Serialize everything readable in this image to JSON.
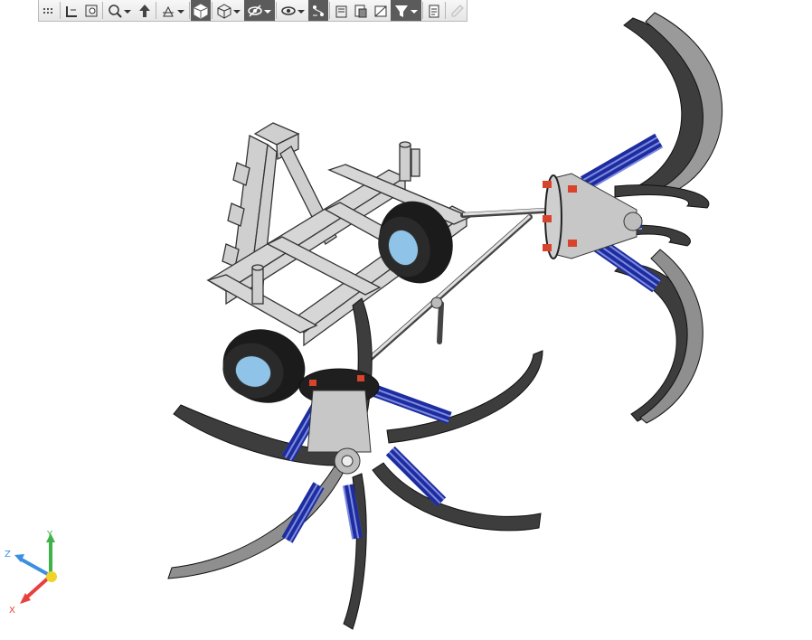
{
  "toolbar": {
    "buttons": [
      {
        "icon": "grip-icon"
      },
      {
        "icon": "zoom-to-fit-icon"
      },
      {
        "icon": "zoom-to-area-icon"
      },
      {
        "icon": "zoom-icon",
        "dropdown": true
      },
      {
        "icon": "previous-view-icon"
      },
      {
        "icon": "section-view-icon",
        "dropdown": true
      },
      {
        "icon": "view-orientation-icon",
        "active": true
      },
      {
        "icon": "display-style-icon",
        "dropdown": true
      },
      {
        "icon": "hide-show-items-icon",
        "active": true,
        "dropdown": true
      },
      {
        "icon": "edit-appearance-icon",
        "dropdown": true
      },
      {
        "icon": "apply-scene-icon",
        "active": true
      },
      {
        "icon": "view-settings-icon"
      },
      {
        "icon": "appearance-list-icon"
      },
      {
        "icon": "realview-icon"
      },
      {
        "icon": "filter-icon",
        "active": true,
        "dropdown": true
      },
      {
        "icon": "document-properties-icon"
      },
      {
        "icon": "pick-color-icon",
        "disabled": true
      }
    ]
  },
  "triad": {
    "x_label": "X",
    "y_label": "Y",
    "z_label": "Z",
    "x_color": "#e8403d",
    "y_color": "#3fb24a",
    "z_color": "#3b8fe0",
    "origin_color": "#f0d22a"
  },
  "model": {
    "frame_color": "#c9c9c9",
    "tine_color": "#3d3d3d",
    "spring_color": "#1a2a9a",
    "tire_color": "#1b1b1b",
    "hub_color": "#8fc3e8",
    "bolt_color": "#d8432c"
  }
}
